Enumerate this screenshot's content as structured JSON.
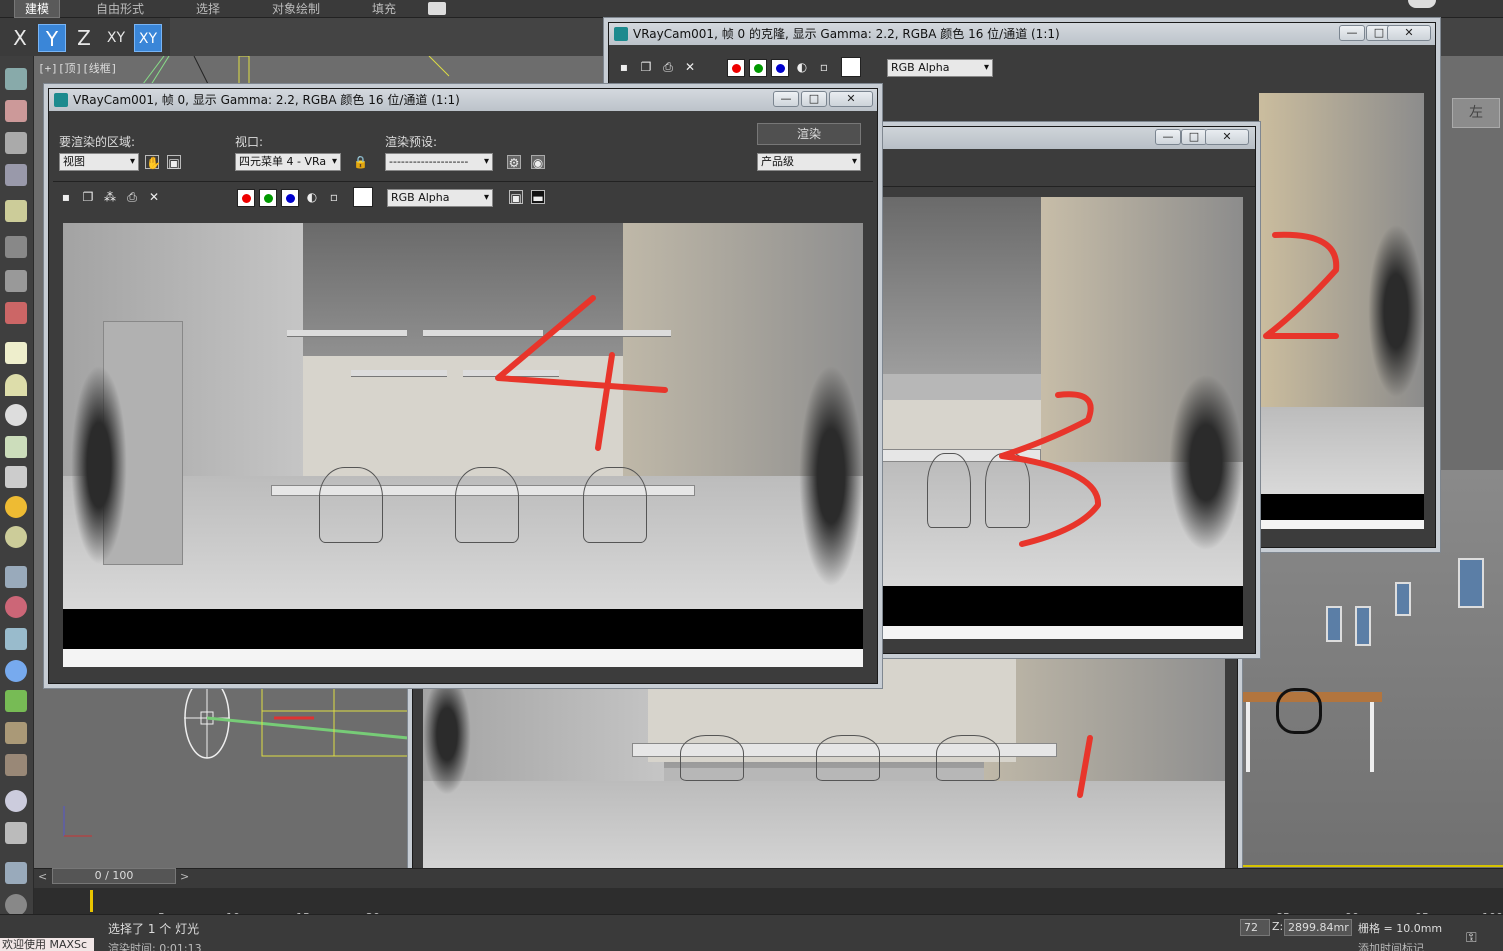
{
  "ribbon": {
    "tabs": [
      "建模",
      "自由形式",
      "选择",
      "对象绘制",
      "填充"
    ]
  },
  "axes": {
    "x": "X",
    "y": "Y",
    "z": "Z",
    "xy": "XY",
    "xy2": "XY"
  },
  "viewport_label": "[+][顶][线框]",
  "viewcube_text": "左",
  "vfb_back": {
    "title": "VRayCam001, 帧 0 的克隆, 显示 Gamma: 2.2, RGBA 颜色 16 位/通道 (1:1)",
    "channel_display": "RGB Alpha"
  },
  "vfb_main": {
    "title": "VRayCam001, 帧 0, 显示 Gamma: 2.2, RGBA 颜色 16 位/通道 (1:1)",
    "area_label": "要渲染的区域:",
    "area_value": "视图",
    "viewport_label": "视口:",
    "viewport_value": "四元菜单 4 - VRa",
    "preset_label": "渲染预设:",
    "preset_value": "--------------------",
    "render_button": "渲染",
    "quality_value": "产品级",
    "channel_display": "RGB Alpha"
  },
  "annotations": {
    "n1": "1",
    "n2": "2",
    "n3": "3",
    "n4": "4"
  },
  "timeline": {
    "slider": "0 / 100",
    "ticks": [
      "5",
      "10",
      "15",
      "20",
      "85",
      "90",
      "95",
      "100"
    ]
  },
  "status": {
    "selection": "选择了 1 个 灯光",
    "render_time": "渲染时间: 0:01:13",
    "welcome": "欢迎使用 MAXSc",
    "coord_x": "72",
    "coord_z_label": "Z:",
    "coord_z": "2899.84mr",
    "grid": "栅格 = 10.0mm",
    "add_time_tag": "添加时间标记"
  },
  "colors": {
    "accent": "#3a86d8",
    "annotation": "#e8352b",
    "title_bar": "#c7cdd4"
  }
}
